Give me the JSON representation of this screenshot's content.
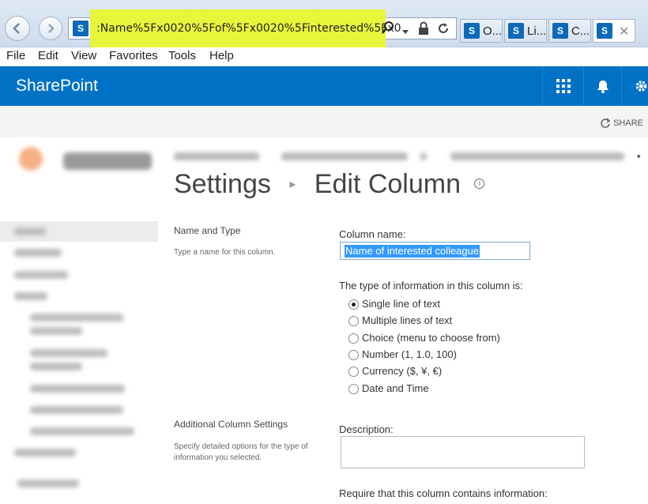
{
  "browser": {
    "address_text": ":Name%5Fx0020%5Fof%5Fx0020%5Finterested%5Fx0",
    "tabs": [
      {
        "label": "O..."
      },
      {
        "label": "Li..."
      },
      {
        "label": "C..."
      },
      {
        "label": ""
      }
    ],
    "favicon_letter": "S",
    "highlight_color": "#e9f53a"
  },
  "menu": [
    "File",
    "Edit",
    "View",
    "Favorites",
    "Tools",
    "Help"
  ],
  "suite": {
    "title": "SharePoint",
    "color": "#0072c6",
    "share_label": "SHARE"
  },
  "page": {
    "title_part1": "Settings",
    "title_sep": "▸",
    "title_part2": "Edit Column",
    "info_glyph": "i"
  },
  "form": {
    "name_type_title": "Name and Type",
    "name_type_desc": "Type a name for this column.",
    "column_name_label": "Column name:",
    "column_name_value": "Name of interested colleague",
    "type_label": "The type of information in this column is:",
    "types": [
      {
        "label": "Single line of text",
        "selected": true
      },
      {
        "label": "Multiple lines of text",
        "selected": false
      },
      {
        "label": "Choice (menu to choose from)",
        "selected": false
      },
      {
        "label": "Number (1, 1.0, 100)",
        "selected": false
      },
      {
        "label": "Currency ($, ¥, €)",
        "selected": false
      },
      {
        "label": "Date and Time",
        "selected": false
      }
    ],
    "additional_title": "Additional Column Settings",
    "additional_desc": "Specify detailed options for the type of information you selected.",
    "description_label": "Description:",
    "require_label": "Require that this column contains information:"
  }
}
